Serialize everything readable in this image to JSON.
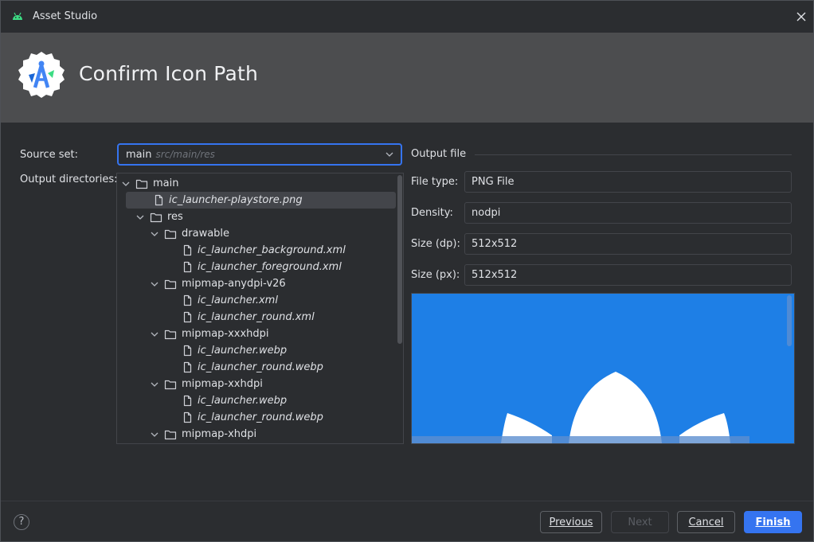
{
  "window": {
    "title": "Asset Studio",
    "header_title": "Confirm Icon Path"
  },
  "form": {
    "source_set_label": "Source set:",
    "source_set_value": "main",
    "source_set_path": "src/main/res",
    "output_dirs_label": "Output directories:"
  },
  "tree": [
    {
      "label": "main",
      "kind": "folder",
      "depth": 0,
      "expanded": true
    },
    {
      "label": "ic_launcher-playstore.png",
      "kind": "file",
      "depth": 1,
      "selected": true
    },
    {
      "label": "res",
      "kind": "folder",
      "depth": 1,
      "expanded": true
    },
    {
      "label": "drawable",
      "kind": "folder",
      "depth": 2,
      "expanded": true
    },
    {
      "label": "ic_launcher_background.xml",
      "kind": "file",
      "depth": 3
    },
    {
      "label": "ic_launcher_foreground.xml",
      "kind": "file",
      "depth": 3
    },
    {
      "label": "mipmap-anydpi-v26",
      "kind": "folder",
      "depth": 2,
      "expanded": true
    },
    {
      "label": "ic_launcher.xml",
      "kind": "file",
      "depth": 3
    },
    {
      "label": "ic_launcher_round.xml",
      "kind": "file",
      "depth": 3
    },
    {
      "label": "mipmap-xxxhdpi",
      "kind": "folder",
      "depth": 2,
      "expanded": true
    },
    {
      "label": "ic_launcher.webp",
      "kind": "file",
      "depth": 3
    },
    {
      "label": "ic_launcher_round.webp",
      "kind": "file",
      "depth": 3
    },
    {
      "label": "mipmap-xxhdpi",
      "kind": "folder",
      "depth": 2,
      "expanded": true
    },
    {
      "label": "ic_launcher.webp",
      "kind": "file",
      "depth": 3
    },
    {
      "label": "ic_launcher_round.webp",
      "kind": "file",
      "depth": 3
    },
    {
      "label": "mipmap-xhdpi",
      "kind": "folder",
      "depth": 2,
      "expanded": true
    }
  ],
  "output_file": {
    "section_title": "Output file",
    "file_type_label": "File type:",
    "file_type_value": "PNG File",
    "density_label": "Density:",
    "density_value": "nodpi",
    "size_dp_label": "Size (dp):",
    "size_dp_value": "512x512",
    "size_px_label": "Size (px):",
    "size_px_value": "512x512"
  },
  "buttons": {
    "help": "?",
    "previous": "Previous",
    "next": "Next",
    "cancel": "Cancel",
    "finish": "Finish"
  },
  "colors": {
    "accent": "#3574f0",
    "preview_background": "#1e7fe6"
  }
}
